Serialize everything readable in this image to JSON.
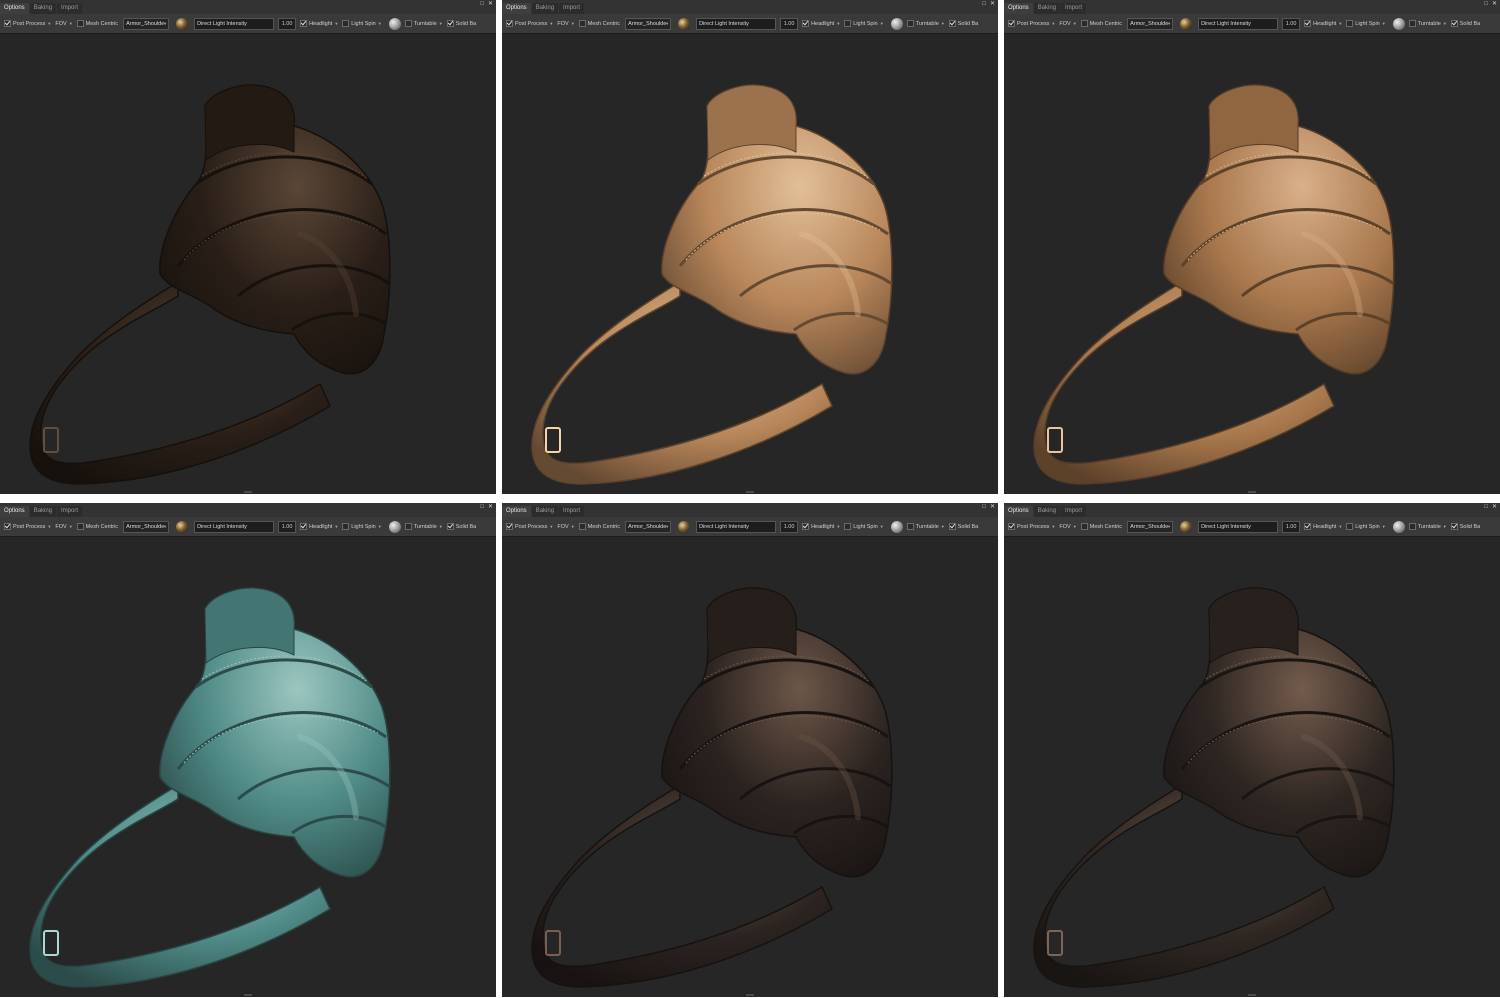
{
  "panels": [
    {
      "tabs": [
        "Options",
        "Baking",
        "Import"
      ],
      "toolbar": {
        "post_process": "Post Process",
        "fov": "FOV",
        "mesh_centric": "Mesh Centric",
        "mesh_select": "Armor_Shoulde",
        "light_field": "Direct Light Intensity",
        "light_value": "1.00",
        "headlight": "Headlight",
        "light_spin": "Light Spin",
        "turntable": "Turntable",
        "solid_bg": "Solid Ba"
      },
      "material_color": "#2a1f18",
      "material_highlight": "#5a4636"
    },
    {
      "tabs": [
        "Options",
        "Baking",
        "Import"
      ],
      "toolbar": {
        "post_process": "Post Process",
        "fov": "FOV",
        "mesh_centric": "Mesh Centric",
        "mesh_select": "Armor_Shoulde",
        "light_field": "Direct Light Intensity",
        "light_value": "1.00",
        "headlight": "Headlight",
        "light_spin": "Light Spin",
        "turntable": "Turntable",
        "solid_bg": "Solid Ba"
      },
      "material_color": "#b8865a",
      "material_highlight": "#e2bf98"
    },
    {
      "tabs": [
        "Options",
        "Baking",
        "Import"
      ],
      "toolbar": {
        "post_process": "Post Process",
        "fov": "FOV",
        "mesh_centric": "Mesh Centric",
        "mesh_select": "Armor_Shoulde",
        "light_field": "Direct Light Intensity",
        "light_value": "1.00",
        "headlight": "Headlight",
        "light_spin": "Light Spin",
        "turntable": "Turntable",
        "solid_bg": "Solid Ba"
      },
      "material_color": "#a9784d",
      "material_highlight": "#d9b08a"
    },
    {
      "tabs": [
        "Options",
        "Baking",
        "Import"
      ],
      "toolbar": {
        "post_process": "Post Process",
        "fov": "FOV",
        "mesh_centric": "Mesh Centric",
        "mesh_select": "Armor_Shoulde",
        "light_field": "Direct Light Intensity",
        "light_value": "1.00",
        "headlight": "Headlight",
        "light_spin": "Light Spin",
        "turntable": "Turntable",
        "solid_bg": "Solid Ba"
      },
      "material_color": "#4f8a86",
      "material_highlight": "#9cc6c0"
    },
    {
      "tabs": [
        "Options",
        "Baking",
        "Import"
      ],
      "toolbar": {
        "post_process": "Post Process",
        "fov": "FOV",
        "mesh_centric": "Mesh Centric",
        "mesh_select": "Armor_Shoulde",
        "light_field": "Direct Light Intensity",
        "light_value": "1.00",
        "headlight": "Headlight",
        "light_spin": "Light Spin",
        "turntable": "Turntable",
        "solid_bg": "Solid Ba"
      },
      "material_color": "#2b2320",
      "material_highlight": "#6d5648"
    },
    {
      "tabs": [
        "Options",
        "Baking",
        "Import"
      ],
      "toolbar": {
        "post_process": "Post Process",
        "fov": "FOV",
        "mesh_centric": "Mesh Centric",
        "mesh_select": "Armor_Shoulde",
        "light_field": "Direct Light Intensity",
        "light_value": "1.00",
        "headlight": "Headlight",
        "light_spin": "Light Spin",
        "turntable": "Turntable",
        "solid_bg": "Solid Ba"
      },
      "material_color": "#2e2622",
      "material_highlight": "#735b4c"
    }
  ],
  "viewport_bg": "#262626"
}
